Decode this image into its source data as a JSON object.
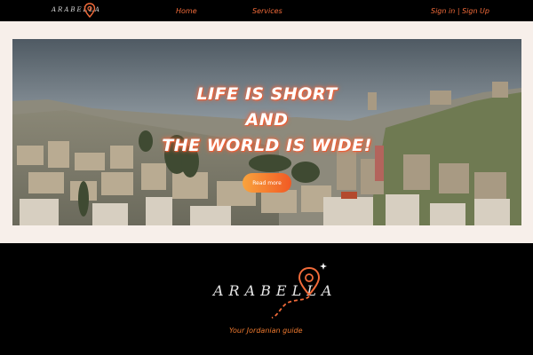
{
  "nav": {
    "logo_text": "ARABELLA",
    "links": [
      {
        "label": "Home"
      },
      {
        "label": "Services"
      },
      {
        "label": "Sign in | Sign Up"
      }
    ]
  },
  "hero": {
    "lines": [
      "LIFE IS SHORT",
      "AND",
      "THE WORLD IS WIDE!"
    ],
    "button_label": "Read more"
  },
  "footer": {
    "logo_text": "ARABELLA",
    "tagline": "Your Jordanian guide"
  },
  "colors": {
    "accent": "#f26b3a",
    "button_start": "#f9a33d",
    "button_end": "#f15a24",
    "frame": "#f7efea",
    "background": "#000000"
  },
  "icons": [
    "map-pin-icon",
    "sparkle-icon",
    "dashed-route-icon"
  ]
}
